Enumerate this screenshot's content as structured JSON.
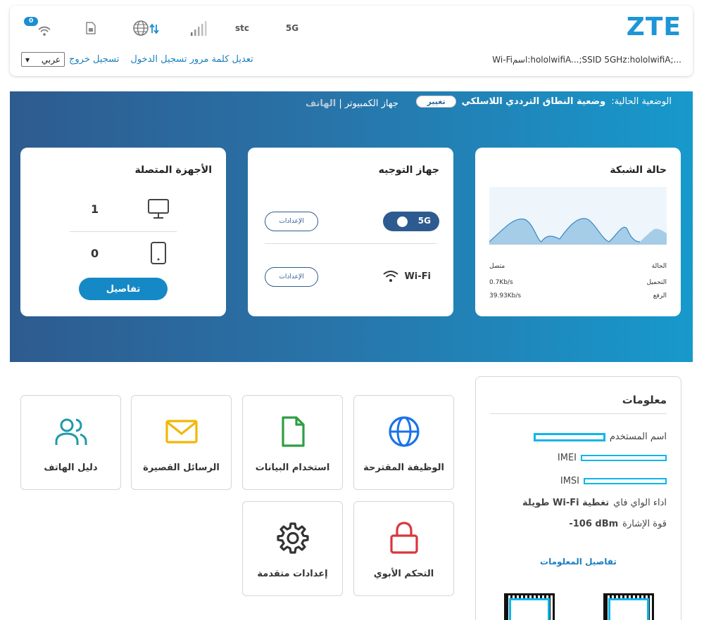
{
  "header": {
    "wifi_badge": "0",
    "carrier": "stc",
    "network_type": "5G",
    "logo": "ZTE",
    "ssid_line": "Wi-Fiاسم:hololwifiA...;SSID 5GHz:hololwifiA;...",
    "language_selected": "عربي",
    "logout_label": "تسجيل خروج",
    "change_password_label": "تعديل كلمة مرور تسجيل الدخول",
    "icons": [
      "wifi-icon",
      "sim-card-icon",
      "globe-data-icon",
      "signal-bars-icon"
    ]
  },
  "banner": {
    "mode_prefix": "الوضعية الحالية:",
    "mode_value": "وضعية النطاق الترددي اللاسلكي",
    "change_label": "تغيير",
    "device_computer": "جهاز الكمبيوتر",
    "device_separator": "|",
    "device_phone": "الهاتف"
  },
  "network_card": {
    "title": "حالة الشبكة",
    "status_label": "الحالة",
    "status_value": "متصل",
    "upload_label": "التحميل",
    "upload_value": "0.7Kb/s",
    "download_label": "الرفع",
    "download_value": "39.93Kb/s"
  },
  "router_card": {
    "title": "جهاز التوجيه",
    "band_label": "5G",
    "band_enabled": true,
    "settings_label": "الإعدادات",
    "wifi_label": "Wi-Fi"
  },
  "devices_card": {
    "title": "الأجهزة المتصلة",
    "computer_count": "1",
    "phone_count": "0",
    "details_label": "تفاصيل"
  },
  "tiles": {
    "recommended": "الوظيفة المقترحة",
    "data_usage": "استخدام البيانات",
    "sms": "الرسائل القصيرة",
    "phonebook": "دليل الهاتف",
    "parental": "التحكم الأبوي",
    "advanced": "إعدادات متقدمة"
  },
  "colors": {
    "accent": "#1589c6",
    "banner_start": "#2e5b8f",
    "banner_end": "#1799cc",
    "globe": "#1a73e8",
    "file": "#2e9e44",
    "mail": "#f2b705",
    "contacts": "#1d9aa8",
    "lock": "#d9363e"
  },
  "info": {
    "title": "معلومات",
    "username_label": "اسم المستخدم",
    "imei_label": "IMEI",
    "imsi_label": "IMSI",
    "wifi_perf_label": "اداء الواي فاي",
    "wifi_perf_value": "تغطية Wi-Fi طويلة",
    "signal_label": "قوة الإشارة",
    "signal_value": "-106 dBm",
    "details_link": "تفاصيل المعلومات"
  }
}
